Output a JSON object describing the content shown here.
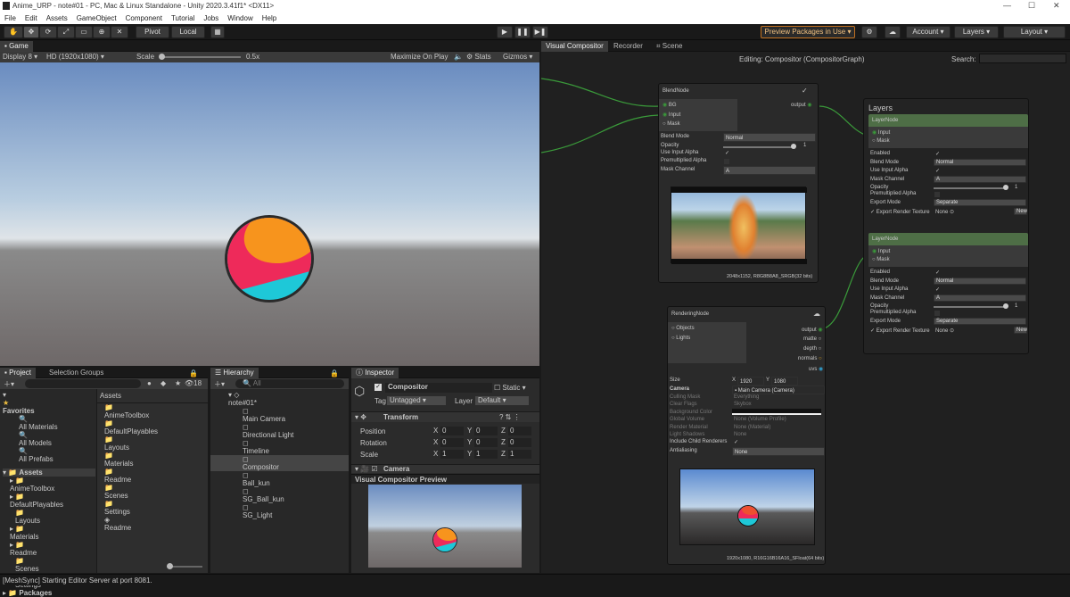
{
  "window": {
    "title": "Anime_URP - note#01 - PC, Mac & Linux Standalone - Unity 2020.3.41f1* <DX11>",
    "min": "—",
    "max": "☐",
    "close": "✕"
  },
  "menu": [
    "File",
    "Edit",
    "Assets",
    "GameObject",
    "Component",
    "Tutorial",
    "Jobs",
    "Window",
    "Help"
  ],
  "toolbar": {
    "pivot": "Pivot",
    "local": "Local",
    "preview_packages": "Preview Packages in Use",
    "account": "Account",
    "layers": "Layers",
    "layout": "Layout"
  },
  "game": {
    "tab": "Game",
    "display": "Display 8",
    "resolution": "HD (1920x1080)",
    "scale_label": "Scale",
    "scale_value": "0.5x",
    "maximize": "Maximize On Play",
    "stats": "Stats",
    "gizmos": "Gizmos"
  },
  "project": {
    "tab1": "Project",
    "tab2": "Selection Groups",
    "count": "18",
    "favorites": "Favorites",
    "fav_items": [
      "All Materials",
      "All Models",
      "All Prefabs"
    ],
    "assets_root": "Assets",
    "tree": [
      "AnimeToolbox",
      "DefaultPlayables",
      "Layouts",
      "Materials",
      "Readme",
      "Scenes",
      "Settings"
    ],
    "packages": "Packages",
    "col_title": "Assets",
    "col_items": [
      "AnimeToolbox",
      "DefaultPlayables",
      "Layouts",
      "Materials",
      "Readme",
      "Scenes",
      "Settings",
      "Readme"
    ]
  },
  "hierarchy": {
    "tab": "Hierarchy",
    "search": "All",
    "scene": "note#01*",
    "items": [
      "Main Camera",
      "Directional Light",
      "Timeline",
      "Compositor",
      "Ball_kun",
      "SG_Ball_kun",
      "SG_Light"
    ]
  },
  "inspector": {
    "tab": "Inspector",
    "object_name": "Compositor",
    "static": "Static",
    "tag_label": "Tag",
    "tag": "Untagged",
    "layer_label": "Layer",
    "layer": "Default",
    "transform": "Transform",
    "position": "Position",
    "rotation": "Rotation",
    "scale": "Scale",
    "pos": [
      "0",
      "0",
      "0"
    ],
    "rot": [
      "0",
      "0",
      "0"
    ],
    "scl": [
      "1",
      "1",
      "1"
    ],
    "camera": "Camera",
    "preview_title": "Visual Compositor Preview"
  },
  "compositor": {
    "tabs": [
      "Visual Compositor",
      "Recorder",
      "Scene"
    ],
    "editing": "Editing: Compositor (CompositorGraph)",
    "search_label": "Search:",
    "blend": {
      "title": "BlendNode",
      "ports_in": [
        "BG",
        "Input",
        "Mask"
      ],
      "port_out": "output",
      "props": [
        [
          "Blend Mode",
          "Normal"
        ],
        [
          "Opacity",
          "1"
        ],
        [
          "Use Input Alpha",
          "✓"
        ],
        [
          "Premultiplied Alpha",
          ""
        ],
        [
          "Mask Channel",
          "A"
        ]
      ],
      "caption": "2048x1152, R8G8B8A8_SRGB(32 bits)"
    },
    "render": {
      "title": "RenderingNode",
      "ports_in": [
        "Objects",
        "Lights"
      ],
      "ports_out": [
        "output",
        "matte",
        "depth",
        "normals",
        "uvs"
      ],
      "size_label": "Size",
      "size_x": "1920",
      "size_y": "1080",
      "camera_label": "Camera",
      "camera": "Main Camera (Camera)",
      "props": [
        [
          "Culling Mask",
          "Everything"
        ],
        [
          "Clear Flags",
          "Skybox"
        ],
        [
          "Background Color",
          ""
        ],
        [
          "Global Volume",
          "None (Volume Profile)"
        ],
        [
          "Render Material",
          "None (Material)"
        ],
        [
          "Light Shadows",
          "None"
        ],
        [
          "Include Child Renderers",
          "✓"
        ],
        [
          "Antialiasing",
          "None"
        ]
      ],
      "caption": "1920x1080, R16G16B16A16_SFloat(64 bits)"
    },
    "layers": {
      "title": "Layers",
      "nodes": [
        {
          "title": "LayerNode",
          "ports": [
            "Input",
            "Mask"
          ],
          "props": [
            [
              "Enabled",
              "✓"
            ],
            [
              "Blend Mode",
              "Normal"
            ],
            [
              "Use Input Alpha",
              "✓"
            ],
            [
              "Mask Channel",
              "A"
            ],
            [
              "Opacity",
              "1"
            ],
            [
              "Premultiplied Alpha",
              ""
            ],
            [
              "Export Mode",
              "Separate"
            ],
            [
              "Export Render Texture",
              "None"
            ]
          ],
          "new": "New"
        },
        {
          "title": "LayerNode",
          "ports": [
            "Input",
            "Mask"
          ],
          "props": [
            [
              "Enabled",
              "✓"
            ],
            [
              "Blend Mode",
              "Normal"
            ],
            [
              "Use Input Alpha",
              "✓"
            ],
            [
              "Mask Channel",
              "A"
            ],
            [
              "Opacity",
              "1"
            ],
            [
              "Premultiplied Alpha",
              ""
            ],
            [
              "Export Mode",
              "Separate"
            ],
            [
              "Export Render Texture",
              "None"
            ]
          ],
          "new": "New"
        }
      ]
    }
  },
  "status": "[MeshSync] Starting Editor Server at port 8081.",
  "colors": {
    "accent": "#6a8a5a",
    "wire": "#3a9a3a",
    "orange": "#f7941d",
    "pink": "#ee2a5a",
    "cyan": "#1ec8d8"
  }
}
